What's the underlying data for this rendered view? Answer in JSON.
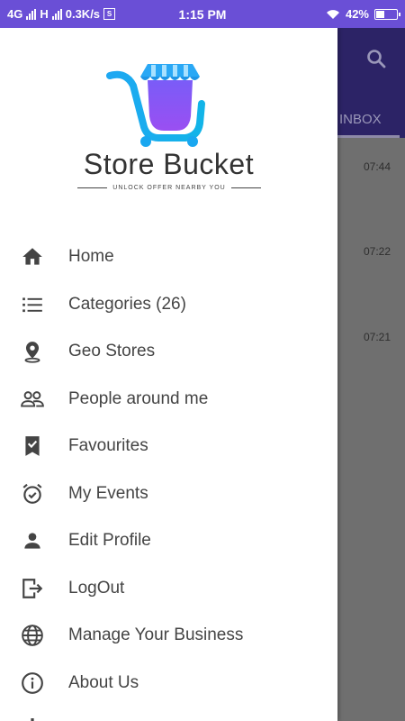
{
  "status_bar": {
    "network1": "4G",
    "network2": "H",
    "speed": "0.3K/s",
    "time": "1:15 PM",
    "battery_pct": "42%",
    "battery_level": 0.42
  },
  "background_app": {
    "tab": "INBOX",
    "times": [
      "07:44",
      "07:22",
      "07:21"
    ]
  },
  "drawer": {
    "brand": "Store Bucket",
    "tagline": "UNLOCK OFFER NEARBY YOU",
    "items": [
      {
        "label": "Home",
        "icon": "home-icon"
      },
      {
        "label": "Categories (26)",
        "icon": "list-icon"
      },
      {
        "label": "Geo Stores",
        "icon": "location-pin-icon"
      },
      {
        "label": "People around me",
        "icon": "people-icon"
      },
      {
        "label": "Favourites",
        "icon": "bookmark-check-icon"
      },
      {
        "label": "My Events",
        "icon": "alarm-check-icon"
      },
      {
        "label": "Edit Profile",
        "icon": "person-icon"
      },
      {
        "label": "LogOut",
        "icon": "logout-icon"
      },
      {
        "label": "Manage Your Business",
        "icon": "globe-icon"
      },
      {
        "label": "About Us",
        "icon": "info-icon"
      }
    ]
  },
  "colors": {
    "status_bar": "#6a4fd6",
    "toolbar": "#2c2366",
    "icon": "#444444",
    "logo_blue": "#19a7f0",
    "logo_purple": "#8a4ff5"
  }
}
